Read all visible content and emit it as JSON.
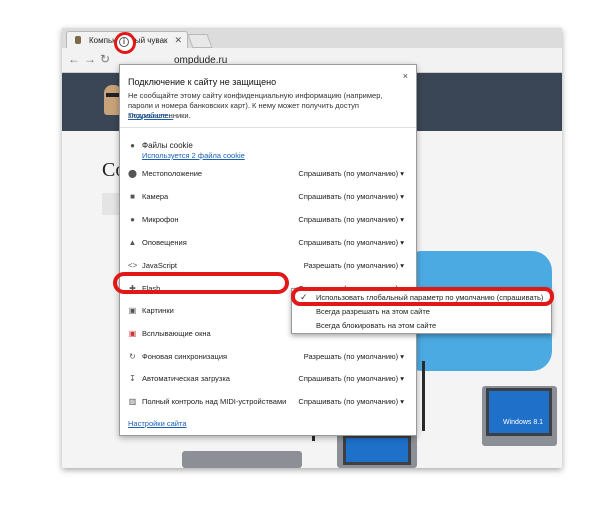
{
  "browser": {
    "tab_title": "Компьютерный чувак",
    "tab_close": "✕",
    "url": "ompdude.ru",
    "info_glyph": "i"
  },
  "page": {
    "title_fragment": "Co"
  },
  "popup": {
    "close": "×",
    "title": "Подключение к сайту не защищено",
    "description": "Не сообщайте этому сайту конфиденциальную информацию (например, пароли и номера банковских карт). К нему может получить доступ злоумышленники.",
    "details_link": "Подробнее...",
    "cookie_label": "Файлы cookie",
    "cookie_link": "Используется 2 файла cookie",
    "rows": [
      {
        "icon": "location-icon",
        "label": "Местоположение",
        "value": "Спрашивать (по умолчанию) ▾"
      },
      {
        "icon": "camera-icon",
        "label": "Камера",
        "value": "Спрашивать (по умолчанию) ▾"
      },
      {
        "icon": "microphone-icon",
        "label": "Микрофон",
        "value": "Спрашивать (по умолчанию) ▾"
      },
      {
        "icon": "bell-icon",
        "label": "Оповещения",
        "value": "Спрашивать (по умолчанию) ▾"
      },
      {
        "icon": "code-icon",
        "label": "JavaScript",
        "value": "Разрешать (по умолчанию) ▾"
      },
      {
        "icon": "puzzle-icon",
        "label": "Flash",
        "value": "Спрашивать (по умолчанию) ▾"
      },
      {
        "icon": "image-icon",
        "label": "Картинки",
        "value": ""
      },
      {
        "icon": "popup-blocked-icon",
        "label": "Всплывающие окна",
        "value": ""
      },
      {
        "icon": "sync-icon",
        "label": "Фоновая синхронизация",
        "value": "Разрешать (по умолчанию) ▾"
      },
      {
        "icon": "download-icon",
        "label": "Автоматическая загрузка",
        "value": "Спрашивать (по умолчанию) ▾"
      },
      {
        "icon": "midi-icon",
        "label": "Полный контроль над MIDI-устройствами",
        "value": "Спрашивать (по умолчанию) ▾"
      }
    ],
    "footer_link": "Настройки сайта"
  },
  "flash_dropdown": {
    "selected_check": "✓",
    "options": [
      "Использовать глобальный параметр по умолчанию (спрашивать)",
      "Всегда разрешать на этом сайте",
      "Всегда блокировать на этом сайте"
    ]
  },
  "illustration": {
    "windows_label": "Windows 8.1"
  },
  "colors": {
    "highlight": "#e01818",
    "link": "#1a5fb4",
    "site_header": "#3a4656"
  }
}
